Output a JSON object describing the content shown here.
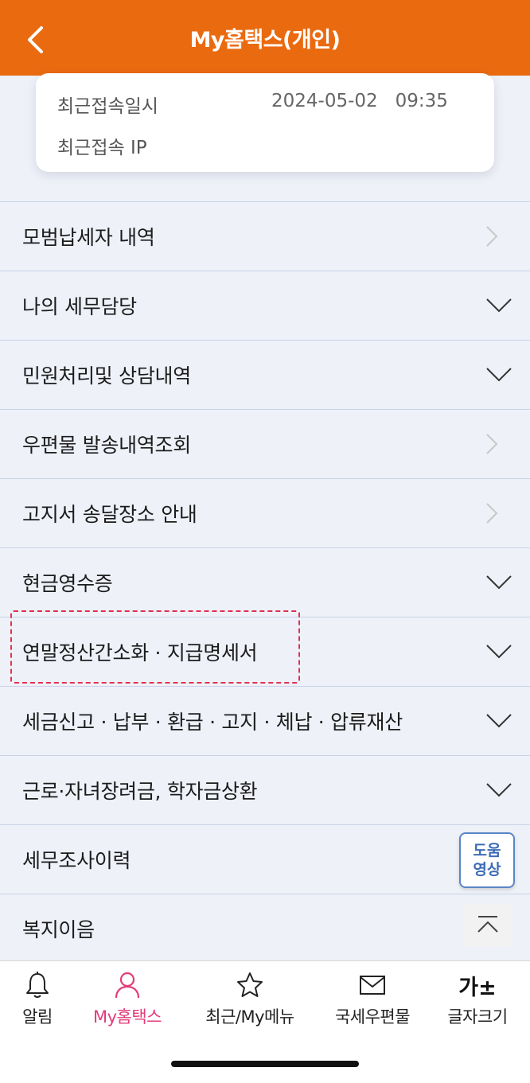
{
  "header": {
    "title": "My홈택스(개인)"
  },
  "info": {
    "last_access_label": "최근접속일시",
    "last_access_value": "2024-05-02   09:35",
    "last_ip_label": "최근접속 IP"
  },
  "menu": {
    "items": [
      {
        "label": "모범납세자 내역",
        "icon": "chevron-right-icon"
      },
      {
        "label": "나의 세무담당",
        "icon": "chevron-down-icon"
      },
      {
        "label": "민원처리및 상담내역",
        "icon": "chevron-down-icon"
      },
      {
        "label": "우편물 발송내역조회",
        "icon": "chevron-right-icon"
      },
      {
        "label": "고지서 송달장소 안내",
        "icon": "chevron-right-icon"
      },
      {
        "label": "현금영수증",
        "icon": "chevron-down-icon"
      },
      {
        "label": "연말정산간소화 · 지급명세서",
        "icon": "chevron-down-icon"
      },
      {
        "label": "세금신고 · 납부 · 환급 · 고지 · 체납 · 압류재산",
        "icon": "chevron-down-icon"
      },
      {
        "label": "근로·자녀장려금, 학자금상환",
        "icon": "chevron-down-icon"
      },
      {
        "label": "세무조사이력",
        "icon": ""
      },
      {
        "label": "복지이음",
        "icon": ""
      }
    ]
  },
  "floating": {
    "help_line1": "도움",
    "help_line2": "영상"
  },
  "bottom_nav": {
    "items": [
      {
        "label": "알림",
        "icon": "bell-icon"
      },
      {
        "label": "My홈택스",
        "icon": "person-icon"
      },
      {
        "label": "최근/My메뉴",
        "icon": "star-icon"
      },
      {
        "label": "국세우편물",
        "icon": "envelope-icon"
      },
      {
        "label": "글자크기",
        "icon_text": "가±"
      }
    ]
  },
  "colors": {
    "header": "#ea6a10",
    "active_nav": "#e23d7a",
    "highlight": "#e23150",
    "help_border": "#5a86c6"
  }
}
